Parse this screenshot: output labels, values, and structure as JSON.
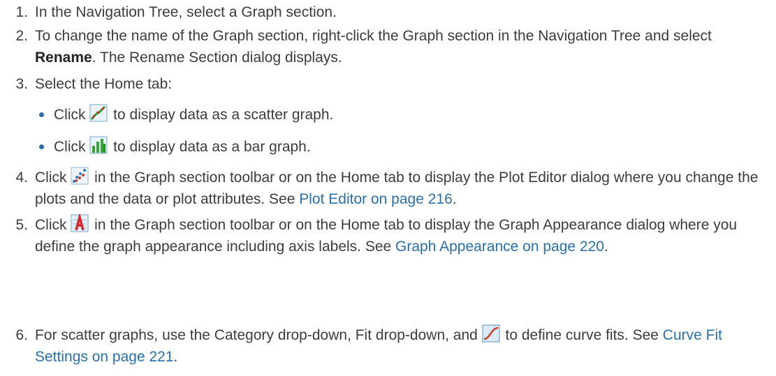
{
  "steps": [
    {
      "num": "1.",
      "text": "In the Navigation Tree, select a Graph section."
    },
    {
      "num": "2.",
      "before": "To change the name of the Graph section, right-click the Graph section in the Navigation Tree and select ",
      "bold": "Rename",
      "after": ". The Rename Section dialog displays."
    },
    {
      "num": "3.",
      "text": "Select the Home tab:"
    },
    {
      "num": "4.",
      "before": "Click",
      "after": " in the Graph section toolbar or on the Home tab to display the Plot Editor dialog where you change the plots and the data or plot attributes. See ",
      "link": "Plot Editor on page 216",
      "end": "."
    },
    {
      "num": "5.",
      "before": "Click",
      "after": " in the Graph section toolbar or on the Home tab to display the Graph Appearance dialog where you define the graph appearance including axis labels. See ",
      "link": "Graph Appearance on page 220",
      "end": "."
    },
    {
      "num": "6.",
      "before": "For scatter graphs, use the Category drop-down, Fit drop-down, and",
      "after": " to define curve fits. See ",
      "link": "Curve Fit Settings on page 221",
      "end": "."
    }
  ],
  "bullets": [
    {
      "before": "Click",
      "after": " to display data as a scatter graph."
    },
    {
      "before": "Click",
      "after": " to display data as a bar graph."
    }
  ],
  "icons": {
    "scatter": "scatter-graph-icon",
    "bar": "bar-graph-icon",
    "plot_editor": "plot-editor-icon",
    "graph_appearance": "graph-appearance-icon",
    "curve_fit": "curve-fit-icon"
  },
  "colors": {
    "text": "#3c3c3c",
    "link": "#2a6fa8",
    "bullet": "#2a6fa8"
  }
}
